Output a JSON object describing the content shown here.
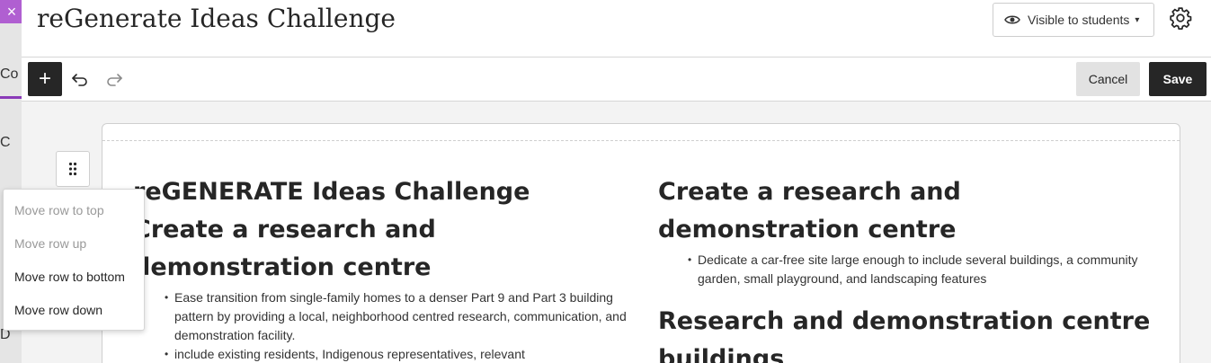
{
  "background": {
    "close_glyph": "×",
    "fragments": [
      "Co",
      "C",
      "D"
    ]
  },
  "header": {
    "title": "reGenerate Ideas Challenge",
    "visibility": {
      "label": "Visible to students",
      "icon": "eye-icon",
      "caret": "chevron-down-icon"
    },
    "settings_icon": "gear-icon"
  },
  "toolbar": {
    "add_icon": "plus-icon",
    "add_glyph": "+",
    "undo_icon": "undo-icon",
    "redo_icon": "redo-icon",
    "cancel_label": "Cancel",
    "save_label": "Save"
  },
  "row_menu": {
    "items": [
      {
        "label": "Move row to top",
        "enabled": false
      },
      {
        "label": "Move row up",
        "enabled": false
      },
      {
        "label": "Move row to bottom",
        "enabled": true
      },
      {
        "label": "Move row down",
        "enabled": true
      }
    ]
  },
  "content": {
    "left": {
      "heading1": "reGENERATE Ideas Challenge",
      "heading2": "Create a research and demonstration centre",
      "bullets": [
        "Ease transition from single-family homes to a denser Part 9 and Part 3 building pattern by providing a local, neighborhood centred research, communication, and demonstration facility.",
        "include existing residents, Indigenous representatives, relevant"
      ]
    },
    "right": {
      "heading1": "Create a research and demonstration centre",
      "bullets": [
        "Dedicate a car-free site large enough to include several buildings, a community garden, small playground, and landscaping features"
      ],
      "heading2": "Research and demonstration centre buildings"
    }
  },
  "colors": {
    "accent_purple": "#b05fd1",
    "dark_button": "#262626",
    "cancel_bg": "#e2e2e2"
  }
}
